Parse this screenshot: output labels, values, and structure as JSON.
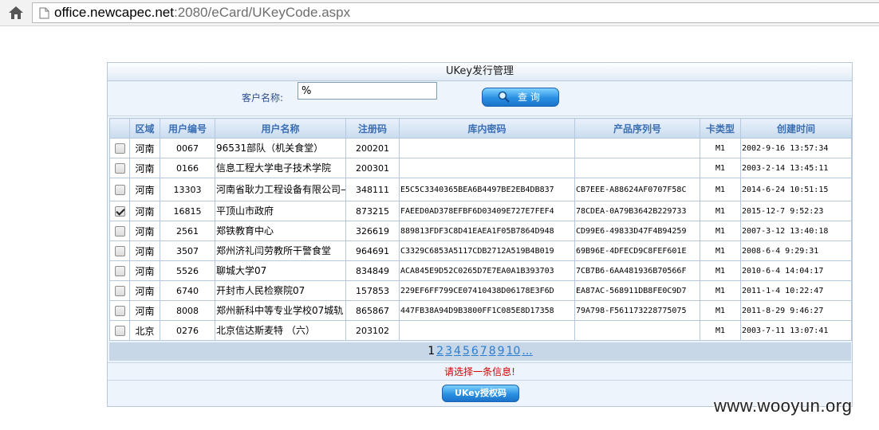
{
  "browser": {
    "url_host": "office.newcapec.net",
    "url_path": ":2080/eCard/UKeyCode.aspx"
  },
  "panel": {
    "title": "UKey发行管理",
    "search_label": "客户名称:",
    "search_value": "%",
    "query_button": "查 询"
  },
  "table": {
    "headers": [
      "区域",
      "用户编号",
      "用户名称",
      "注册码",
      "库内密码",
      "产品序列号",
      "卡类型",
      "创建时间"
    ],
    "rows": [
      {
        "checked": false,
        "area": "河南",
        "id": "0067",
        "name": "96531部队（机关食堂）",
        "reg": "200201",
        "pwd": "",
        "serial": "",
        "type": "M1",
        "time": "2002-9-16 13:57:34"
      },
      {
        "checked": false,
        "area": "河南",
        "id": "0166",
        "name": "信息工程大学电子技术学院",
        "reg": "200301",
        "pwd": "",
        "serial": "",
        "type": "M1",
        "time": "2003-2-14 13:45:11"
      },
      {
        "checked": false,
        "area": "河南",
        "id": "13303",
        "name": "河南省耿力工程设备有限公司—E",
        "reg": "348111",
        "pwd": "E5C5C3340365BEA6B4497BE2EB4DB837",
        "serial": "CB7EEE-A88624AF0707F58C",
        "type": "M1",
        "time": "2014-6-24 10:51:15"
      },
      {
        "checked": true,
        "area": "河南",
        "id": "16815",
        "name": "平顶山市政府",
        "reg": "873215",
        "pwd": "FAEED0AD378EFBF6D03409E727E7FEF4",
        "serial": "78CDEA-0A79B3642B229733",
        "type": "M1",
        "time": "2015-12-7 9:52:23"
      },
      {
        "checked": false,
        "area": "河南",
        "id": "2561",
        "name": "郑铁教育中心",
        "reg": "326619",
        "pwd": "889813FDF3C8D41EAEA1F05B7864D948",
        "serial": "CD99E6-49833D47F4B94259",
        "type": "M1",
        "time": "2007-3-12 13:40:18"
      },
      {
        "checked": false,
        "area": "河南",
        "id": "3507",
        "name": "郑州济礼闫劳教所干警食堂",
        "reg": "964691",
        "pwd": "C3329C6853A5117CDB2712A519B4B019",
        "serial": "69B96E-4DFECD9C8FEF601E",
        "type": "M1",
        "time": "2008-6-4 9:29:31"
      },
      {
        "checked": false,
        "area": "河南",
        "id": "5526",
        "name": "聊城大学07",
        "reg": "834849",
        "pwd": "ACA845E9D52C0265D7E7EA0A1B393703",
        "serial": "7CB7B6-6AA481936B70566F",
        "type": "M1",
        "time": "2010-6-4 14:04:17"
      },
      {
        "checked": false,
        "area": "河南",
        "id": "6740",
        "name": "开封市人民检察院07",
        "reg": "157853",
        "pwd": "229EF6FF799CE07410438D06178E3F6D",
        "serial": "EA87AC-568911DB8FE0C9D7",
        "type": "M1",
        "time": "2011-1-4 10:22:47"
      },
      {
        "checked": false,
        "area": "河南",
        "id": "8008",
        "name": "郑州新科中等专业学校07城轨",
        "reg": "865867",
        "pwd": "447FB38A94D9B3800FF1C085E8D17358",
        "serial": "79A798-F561173228775075",
        "type": "M1",
        "time": "2011-8-29 9:46:27"
      },
      {
        "checked": false,
        "area": "北京",
        "id": "0276",
        "name": "北京信达斯麦特 （六）",
        "reg": "203102",
        "pwd": "",
        "serial": "",
        "type": "M1",
        "time": "2003-7-11 13:07:41"
      }
    ]
  },
  "pager": {
    "current": "1",
    "pages": [
      "2",
      "3",
      "4",
      "5",
      "6",
      "7",
      "8",
      "9",
      "10",
      "..."
    ]
  },
  "message": "请选择一条信息!",
  "ukey_button": "UKey授权码",
  "watermark": "www.wooyun.org",
  "colors": {
    "header_text": "#3b6fb3",
    "message": "#d40000",
    "button": "#2a90e2",
    "link": "#2a7dd1"
  }
}
